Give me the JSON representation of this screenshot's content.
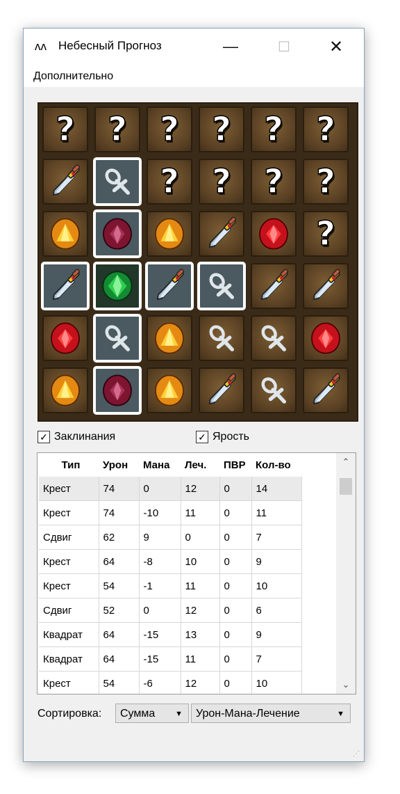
{
  "window": {
    "app_icon": "dragonfly-icon",
    "title": "Небесный Прогноз",
    "minimize": "—",
    "maximize": "☐",
    "close": "✕"
  },
  "menu": {
    "items": [
      "Дополнительно"
    ]
  },
  "board": {
    "rows": [
      [
        "?",
        "?",
        "?",
        "?",
        "?",
        "?"
      ],
      [
        "sword",
        "ankh",
        "?",
        "?",
        "?",
        "?"
      ],
      [
        "gold",
        "ruby_dark",
        "gold",
        "sword",
        "ruby",
        "?"
      ],
      [
        "sword",
        "emerald",
        "sword",
        "ankh",
        "sword",
        "sword"
      ],
      [
        "ruby",
        "ankh",
        "gold",
        "ankh",
        "ankh",
        "ruby"
      ],
      [
        "gold",
        "ruby_dark",
        "gold",
        "sword",
        "ankh",
        "sword"
      ]
    ],
    "selected": [
      [
        1,
        1
      ],
      [
        2,
        1
      ],
      [
        3,
        0
      ],
      [
        3,
        1
      ],
      [
        3,
        2
      ],
      [
        3,
        3
      ],
      [
        4,
        1
      ],
      [
        5,
        1
      ]
    ],
    "qmark_text": "?"
  },
  "options": {
    "spells": {
      "label": "Заклинания",
      "checked": true,
      "mark": "✓"
    },
    "rage": {
      "label": "Ярость",
      "checked": true,
      "mark": "✓"
    }
  },
  "table": {
    "headers": [
      "Тип",
      "Урон",
      "Мана",
      "Леч.",
      "ПВР",
      "Кол-во"
    ],
    "rows": [
      [
        "Крест",
        "74",
        "0",
        "12",
        "0",
        "14"
      ],
      [
        "Крест",
        "74",
        "-10",
        "11",
        "0",
        "11"
      ],
      [
        "Сдвиг",
        "62",
        "9",
        "0",
        "0",
        "7"
      ],
      [
        "Крест",
        "64",
        "-8",
        "10",
        "0",
        "9"
      ],
      [
        "Крест",
        "54",
        "-1",
        "11",
        "0",
        "10"
      ],
      [
        "Сдвиг",
        "52",
        "0",
        "12",
        "0",
        "6"
      ],
      [
        "Квадрат",
        "64",
        "-15",
        "13",
        "0",
        "9"
      ],
      [
        "Квадрат",
        "64",
        "-15",
        "11",
        "0",
        "7"
      ],
      [
        "Крест",
        "54",
        "-6",
        "12",
        "0",
        "10"
      ]
    ],
    "selected_row": 0,
    "scroll_up": "⌃",
    "scroll_down": "⌄"
  },
  "sort": {
    "label": "Сортировка:",
    "mode": "Сумма",
    "order": "Урон-Мана-Лечение",
    "arrow": "▼"
  },
  "colors": {
    "board_bg": "#3a2b19",
    "selection_outline": "#ffffff"
  }
}
